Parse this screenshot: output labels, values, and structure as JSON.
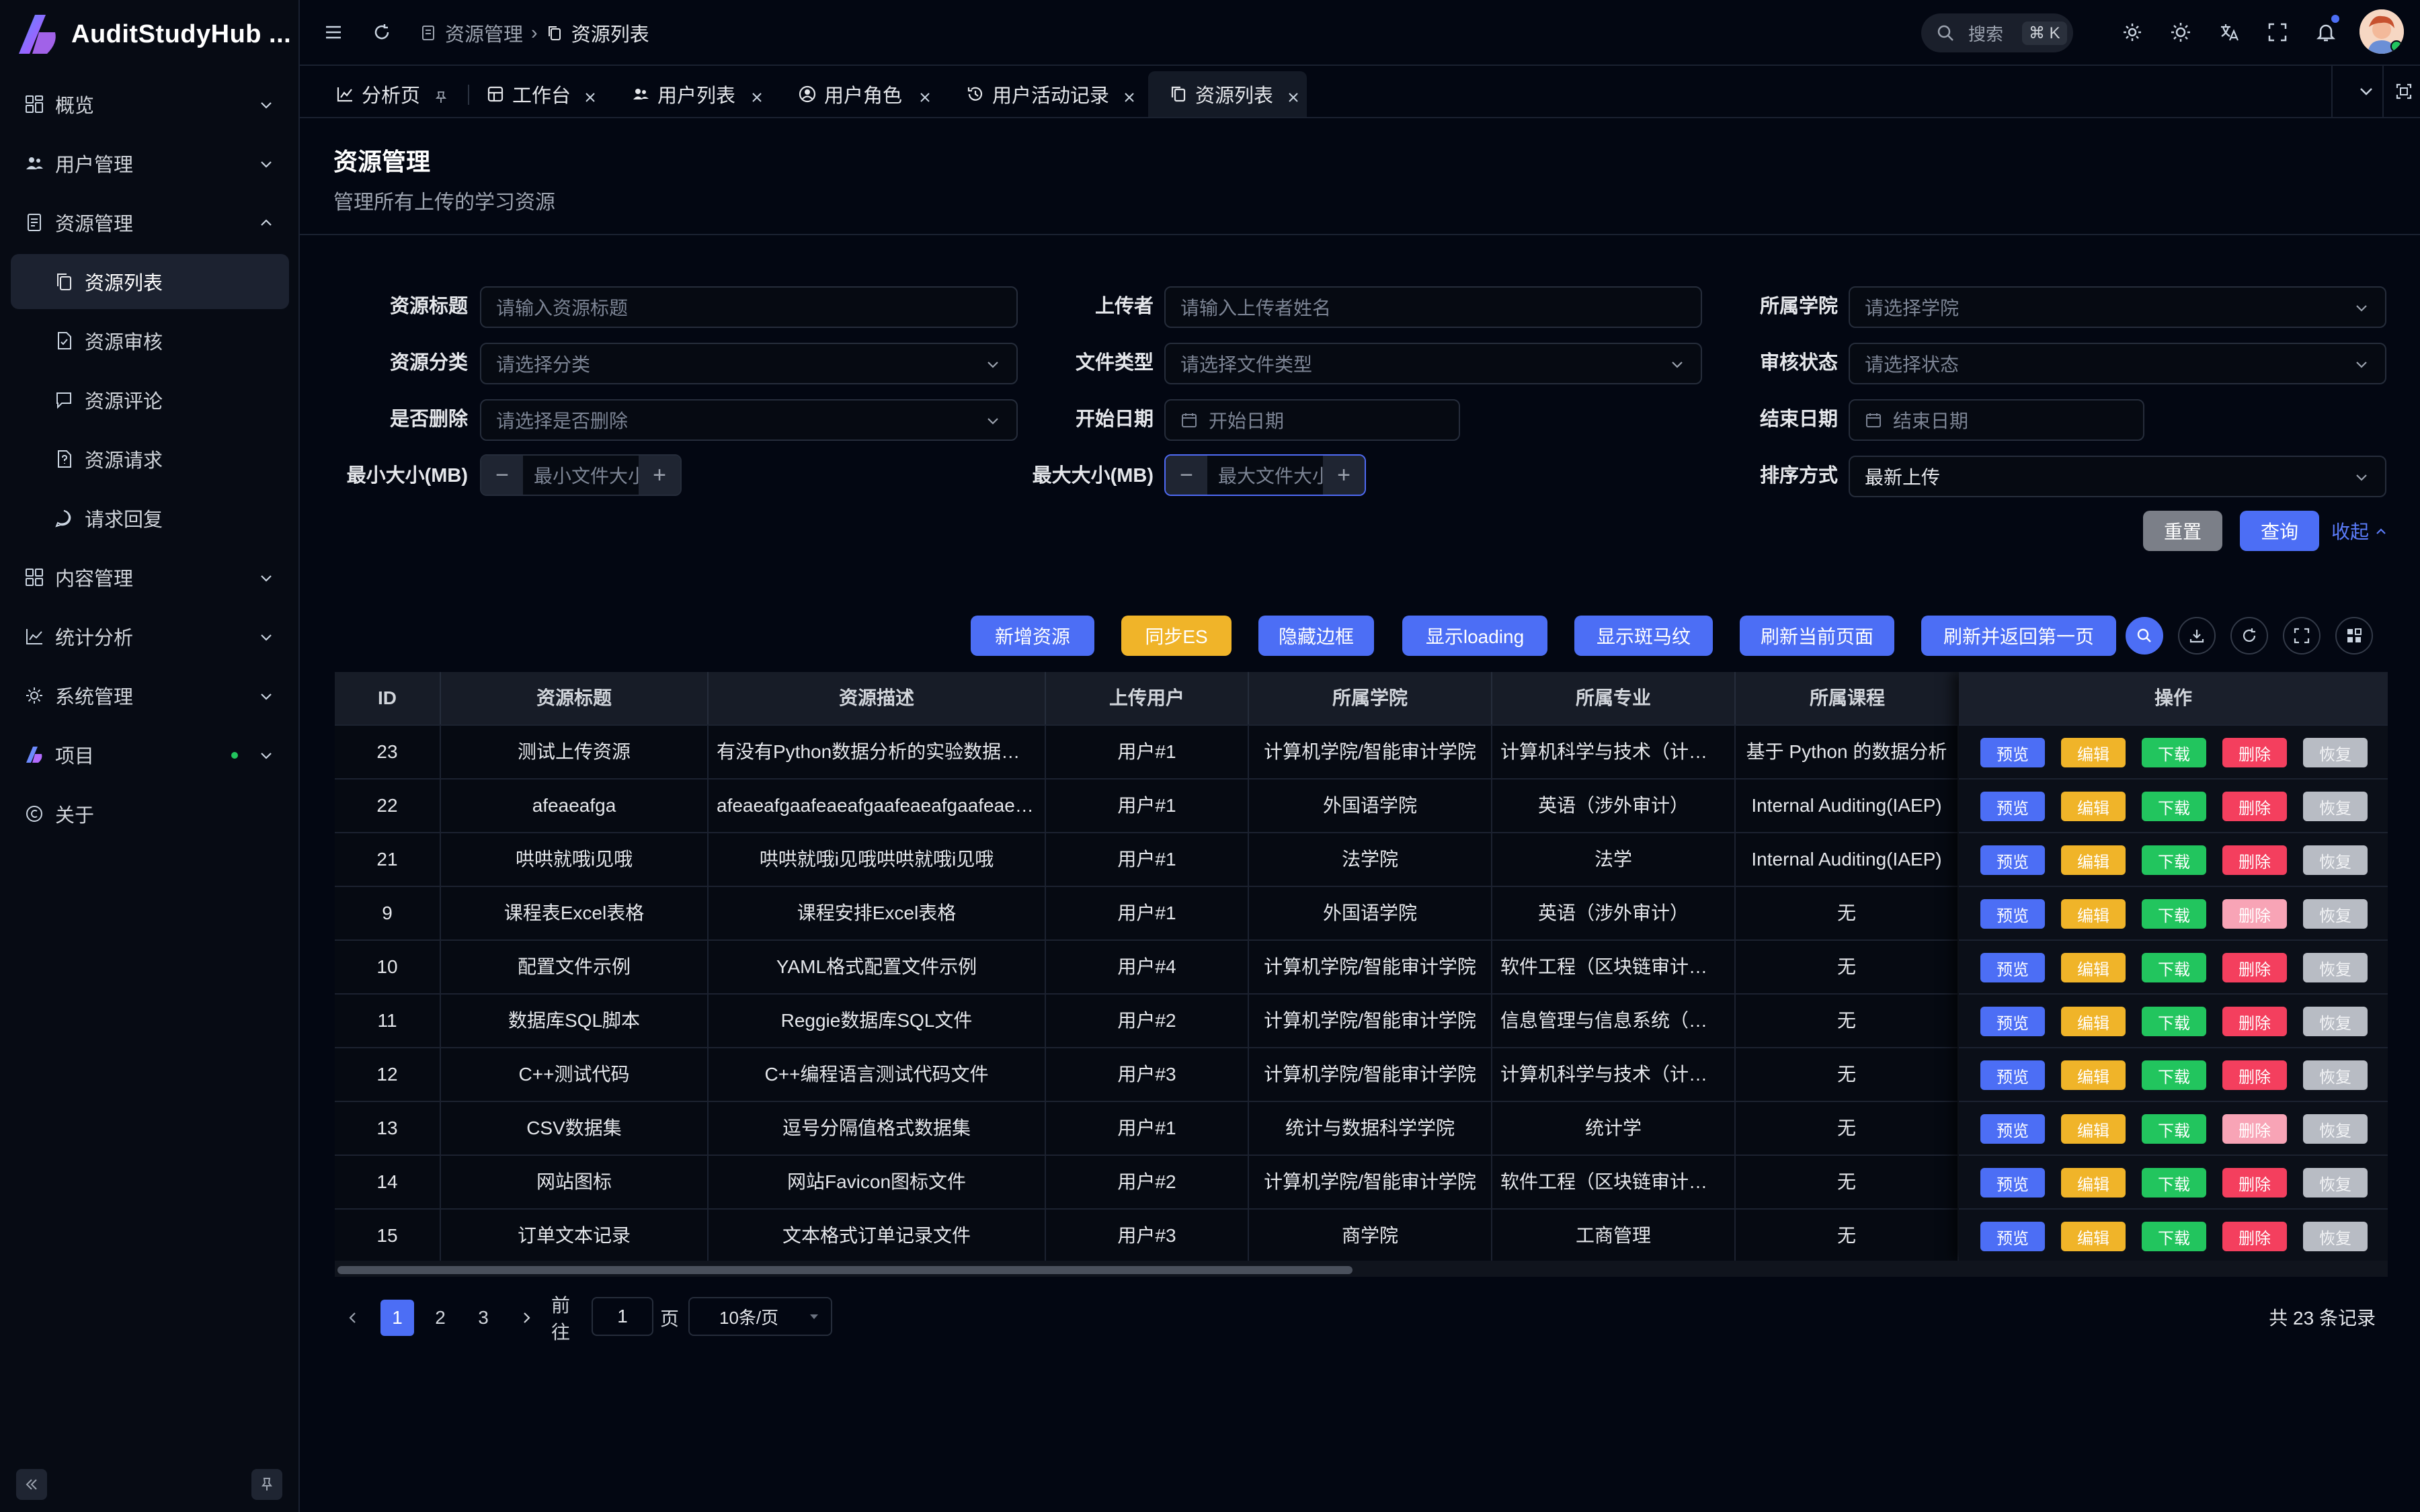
{
  "app": {
    "name": "AuditStudyHub ...",
    "brand_color": "#4c6ef5"
  },
  "sidebar": {
    "items": [
      {
        "label": "概览",
        "icon": "dashboard-icon"
      },
      {
        "label": "用户管理",
        "icon": "users-icon"
      },
      {
        "label": "资源管理",
        "icon": "document-icon",
        "expanded": true
      },
      {
        "label": "资源列表",
        "icon": "copy-icon",
        "active": true
      },
      {
        "label": "资源审核",
        "icon": "file-check-icon"
      },
      {
        "label": "资源评论",
        "icon": "comment-icon"
      },
      {
        "label": "资源请求",
        "icon": "file-question-icon"
      },
      {
        "label": "请求回复",
        "icon": "reply-icon"
      },
      {
        "label": "内容管理",
        "icon": "grid-icon"
      },
      {
        "label": "统计分析",
        "icon": "chart-icon"
      },
      {
        "label": "系统管理",
        "icon": "gear-icon"
      },
      {
        "label": "项目",
        "icon": "project-logo-icon"
      },
      {
        "label": "关于",
        "icon": "copyright-icon"
      }
    ]
  },
  "header": {
    "breadcrumb": [
      "资源管理",
      "资源列表"
    ],
    "search_label": "搜索",
    "search_shortcut": "⌘ K"
  },
  "tabs": [
    {
      "label": "分析页",
      "icon": "chart-icon",
      "pinned": true
    },
    {
      "label": "工作台",
      "icon": "workspace-icon"
    },
    {
      "label": "用户列表",
      "icon": "users-icon"
    },
    {
      "label": "用户角色",
      "icon": "user-circle-icon"
    },
    {
      "label": "用户活动记录",
      "icon": "history-icon"
    },
    {
      "label": "资源列表",
      "icon": "copy-icon",
      "active": true
    }
  ],
  "page": {
    "title": "资源管理",
    "subtitle": "管理所有上传的学习资源"
  },
  "filters": {
    "title_label": "资源标题",
    "title_placeholder": "请输入资源标题",
    "uploader_label": "上传者",
    "uploader_placeholder": "请输入上传者姓名",
    "college_label": "所属学院",
    "college_placeholder": "请选择学院",
    "category_label": "资源分类",
    "category_placeholder": "请选择分类",
    "filetype_label": "文件类型",
    "filetype_placeholder": "请选择文件类型",
    "audit_label": "审核状态",
    "audit_placeholder": "请选择状态",
    "deleted_label": "是否删除",
    "deleted_placeholder": "请选择是否删除",
    "start_label": "开始日期",
    "start_placeholder": "开始日期",
    "end_label": "结束日期",
    "end_placeholder": "结束日期",
    "minsize_label": "最小大小(MB)",
    "minsize_placeholder": "最小文件大小",
    "maxsize_label": "最大大小(MB)",
    "maxsize_placeholder": "最大文件大小",
    "sort_label": "排序方式",
    "sort_value": "最新上传",
    "reset": "重置",
    "query": "查询",
    "collapse": "收起"
  },
  "toolbar": {
    "add": "新增资源",
    "sync": "同步ES",
    "hide_border": "隐藏边框",
    "show_loading": "显示loading",
    "show_stripe": "显示斑马纹",
    "refresh_current": "刷新当前页面",
    "refresh_first": "刷新并返回第一页"
  },
  "table": {
    "columns": [
      "ID",
      "资源标题",
      "资源描述",
      "上传用户",
      "所属学院",
      "所属专业",
      "所属课程",
      "操作"
    ],
    "actions": {
      "preview": "预览",
      "edit": "编辑",
      "download": "下载",
      "delete": "删除",
      "restore": "恢复"
    },
    "rows": [
      {
        "id": "23",
        "title": "测试上传资源",
        "desc": "有没有Python数据分析的实验数据集啊?",
        "user": "用户#1",
        "college": "计算机学院/智能审计学院",
        "major": "计算机科学与技术（计算机...",
        "course": "基于 Python 的数据分析",
        "deleted": false
      },
      {
        "id": "22",
        "title": "afeaeafga",
        "desc": "afeaeafgaafeaeafgaafeaeafgaafeaeaf...",
        "user": "用户#1",
        "college": "外国语学院",
        "major": "英语（涉外审计）",
        "course": "Internal Auditing(IAEP)",
        "deleted": false
      },
      {
        "id": "21",
        "title": "哄哄就哦i见哦",
        "desc": "哄哄就哦i见哦哄哄就哦i见哦",
        "user": "用户#1",
        "college": "法学院",
        "major": "法学",
        "course": "Internal Auditing(IAEP)",
        "deleted": false
      },
      {
        "id": "9",
        "title": "课程表Excel表格",
        "desc": "课程安排Excel表格",
        "user": "用户#1",
        "college": "外国语学院",
        "major": "英语（涉外审计）",
        "course": "无",
        "deleted": true
      },
      {
        "id": "10",
        "title": "配置文件示例",
        "desc": "YAML格式配置文件示例",
        "user": "用户#4",
        "college": "计算机学院/智能审计学院",
        "major": "软件工程（区块链审计方向...",
        "course": "无",
        "deleted": false
      },
      {
        "id": "11",
        "title": "数据库SQL脚本",
        "desc": "Reggie数据库SQL文件",
        "user": "用户#2",
        "college": "计算机学院/智能审计学院",
        "major": "信息管理与信息系统（信息...",
        "course": "无",
        "deleted": false
      },
      {
        "id": "12",
        "title": "C++测试代码",
        "desc": "C++编程语言测试代码文件",
        "user": "用户#3",
        "college": "计算机学院/智能审计学院",
        "major": "计算机科学与技术（计算机...",
        "course": "无",
        "deleted": false
      },
      {
        "id": "13",
        "title": "CSV数据集",
        "desc": "逗号分隔值格式数据集",
        "user": "用户#1",
        "college": "统计与数据科学学院",
        "major": "统计学",
        "course": "无",
        "deleted": true
      },
      {
        "id": "14",
        "title": "网站图标",
        "desc": "网站Favicon图标文件",
        "user": "用户#2",
        "college": "计算机学院/智能审计学院",
        "major": "软件工程（区块链审计方向...",
        "course": "无",
        "deleted": false
      },
      {
        "id": "15",
        "title": "订单文本记录",
        "desc": "文本格式订单记录文件",
        "user": "用户#3",
        "college": "商学院",
        "major": "工商管理",
        "course": "无",
        "deleted": false
      }
    ]
  },
  "pagination": {
    "pages": [
      "1",
      "2",
      "3"
    ],
    "current": "1",
    "goto_label": "前往",
    "goto_value": "1",
    "page_suffix": "页",
    "page_size": "10条/页",
    "total": "共 23 条记录"
  }
}
